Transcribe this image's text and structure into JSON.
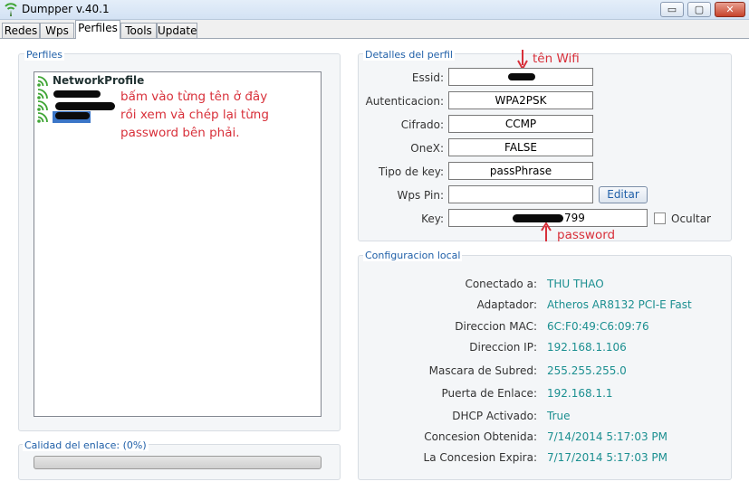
{
  "window": {
    "title": "Dumpper v.40.1",
    "minimize": "▭",
    "maximize": "▢",
    "close": "✕"
  },
  "tabs": [
    {
      "label": "Redes"
    },
    {
      "label": "Wps"
    },
    {
      "label": "Perfiles"
    },
    {
      "label": "Tools"
    },
    {
      "label": "Update"
    }
  ],
  "perfiles": {
    "group_label": "Perfiles",
    "items": [
      {
        "label": "NetworkProfile"
      }
    ]
  },
  "annotations": {
    "list_hint": [
      "bấm vào từng tên ở đây",
      "rồi xem và chép lại từng",
      "password bên phải."
    ],
    "wifi_name": "tên Wifi",
    "password": "password"
  },
  "detalles": {
    "group_label": "Detalles del perfil",
    "essid_label": "Essid:",
    "autenticacion_label": "Autenticacion:",
    "autenticacion_value": "WPA2PSK",
    "cifrado_label": "Cifrado:",
    "cifrado_value": "CCMP",
    "onex_label": "OneX:",
    "onex_value": "FALSE",
    "tipo_key_label": "Tipo de key:",
    "tipo_key_value": "passPhrase",
    "wps_pin_label": "Wps Pin:",
    "wps_pin_value": "",
    "editar_button": "Editar",
    "key_label": "Key:",
    "key_visible_suffix": "799",
    "ocultar_label": "Ocultar"
  },
  "config": {
    "group_label": "Configuracion local",
    "rows": [
      {
        "label": "Conectado a:",
        "value": "THU THAO"
      },
      {
        "label": "Adaptador:",
        "value": "Atheros AR8132 PCI-E Fast"
      },
      {
        "label": "Direccion MAC:",
        "value": "6C:F0:49:C6:09:76"
      },
      {
        "label": "Direccion IP:",
        "value": "192.168.1.106"
      },
      {
        "label": "Mascara de Subred:",
        "value": "255.255.255.0"
      },
      {
        "label": "Puerta de Enlace:",
        "value": "192.168.1.1"
      },
      {
        "label": "DHCP Activado:",
        "value": "True"
      },
      {
        "label": "Concesion Obtenida:",
        "value": "7/14/2014 5:17:03 PM"
      },
      {
        "label": "La Concesion Expira:",
        "value": "7/17/2014 5:17:03 PM"
      }
    ]
  },
  "calidad": {
    "label": "Calidad del enlace: (0%)",
    "progress_fraction": 0.0
  },
  "colors": {
    "accent_blue": "#1f5fa8",
    "value_teal": "#1b8f90",
    "annotation_red": "#d8303a",
    "wifi_green": "#3fa535"
  }
}
